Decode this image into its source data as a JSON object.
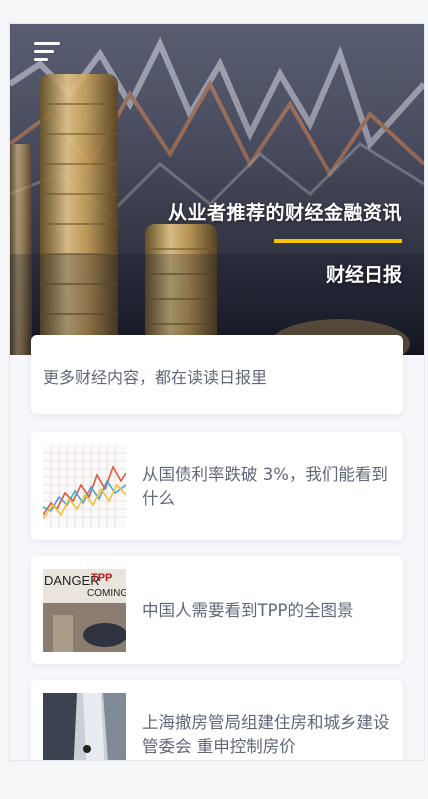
{
  "header": {
    "menu_icon": "hamburger-menu-icon",
    "title": "从业者推荐的财经金融资讯",
    "subtitle": "财经日报",
    "accent_color": "#f5c400"
  },
  "intro": {
    "text": "更多财经内容，都在读读日报里"
  },
  "news": [
    {
      "title": "从国债利率跌破 3%，我们能看到什么"
    },
    {
      "title": "中国人需要看到TPP的全图景"
    },
    {
      "title": "上海撤房管局组建住房和城乡建设管委会 重申控制房价"
    }
  ],
  "thumbnails": {
    "tpp_text_1": "DANGER",
    "tpp_text_2": "TPP",
    "tpp_text_3": "COMING"
  }
}
